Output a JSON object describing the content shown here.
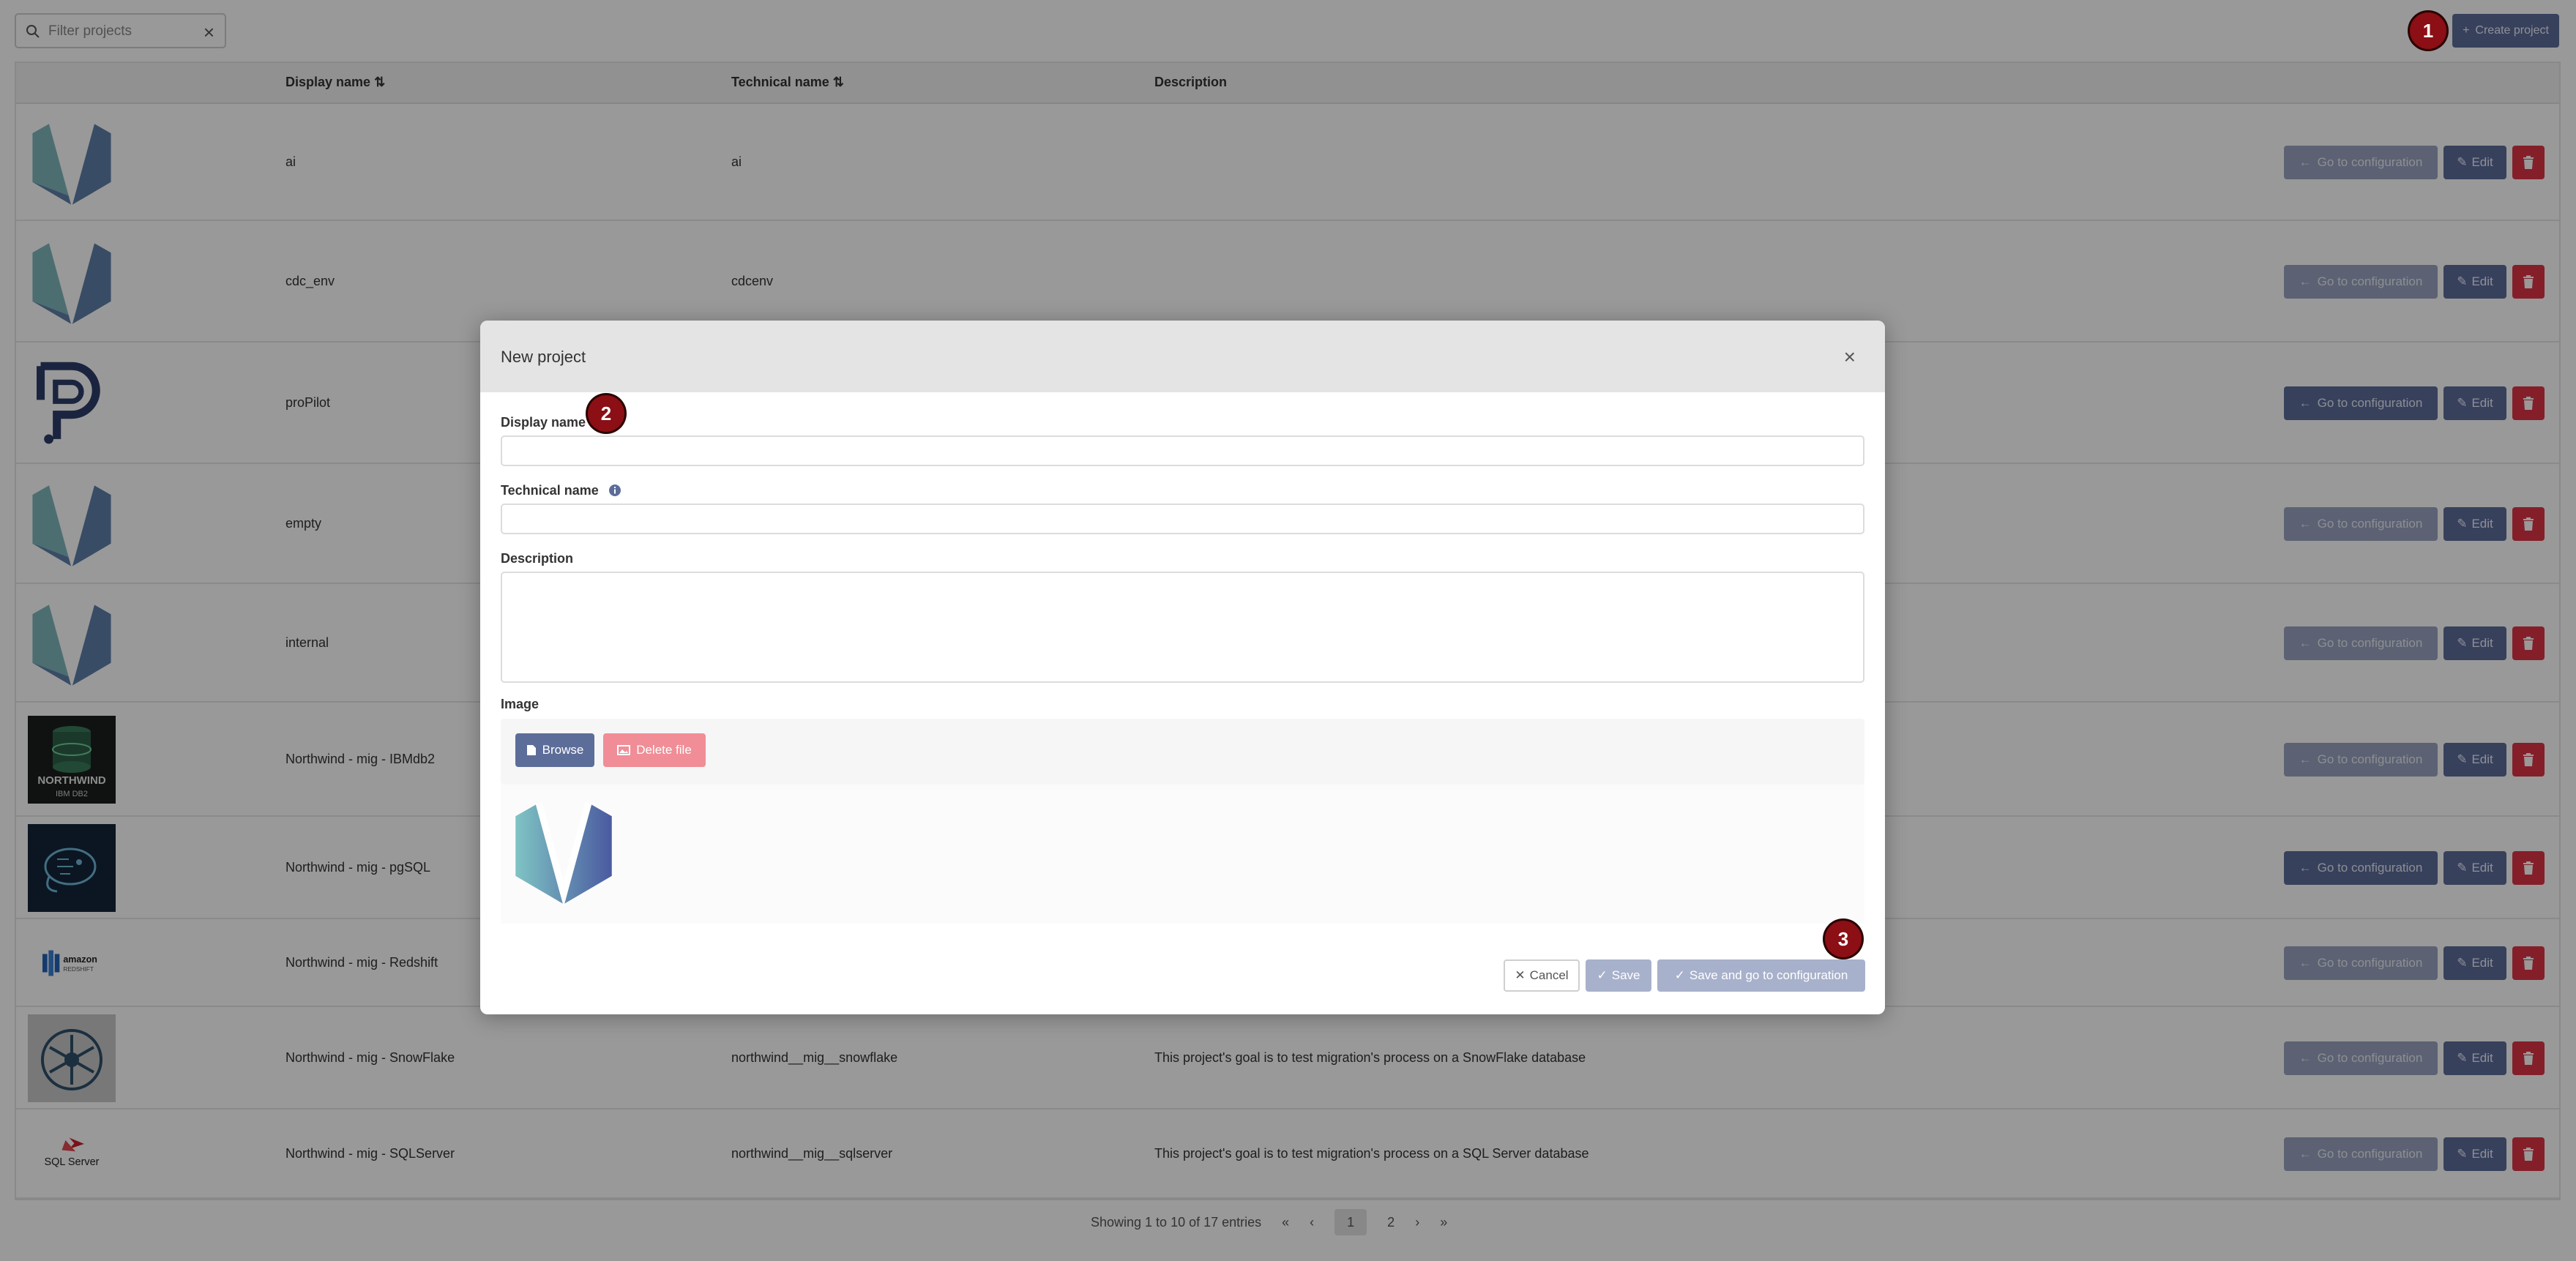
{
  "filter": {
    "placeholder": "Filter projects",
    "clear": "×"
  },
  "create_button": {
    "label": "Create project",
    "icon": "plus-icon"
  },
  "table": {
    "headers": {
      "display_name": "Display name",
      "technical_name": "Technical name",
      "description": "Description"
    },
    "sort_glyph": "⇅",
    "rows": [
      {
        "display_name": "ai",
        "technical_name": "ai",
        "description": "",
        "logo": "vorteks"
      },
      {
        "display_name": "cdc_env",
        "technical_name": "cdcenv",
        "description": "",
        "logo": "vorteks"
      },
      {
        "display_name": "proPilot",
        "technical_name": "",
        "description": "",
        "logo": "propilot"
      },
      {
        "display_name": "empty",
        "technical_name": "",
        "description": "",
        "logo": "vorteks"
      },
      {
        "display_name": "internal",
        "technical_name": "",
        "description": "",
        "logo": "vorteks"
      },
      {
        "display_name": "Northwind - mig - IBMdb2",
        "technical_name": "",
        "description": "",
        "logo": "northwind",
        "logo_text_1": "NORTHWIND",
        "logo_text_2": "IBM DB2"
      },
      {
        "display_name": "Northwind - mig - pgSQL",
        "technical_name": "",
        "description": "",
        "logo": "pgsql"
      },
      {
        "display_name": "Northwind - mig - Redshift",
        "technical_name": "",
        "description": "",
        "logo": "redshift",
        "logo_text_1": "amazon",
        "logo_text_2": "REDSHIFT"
      },
      {
        "display_name": "Northwind - mig - SnowFlake",
        "technical_name": "northwind__mig__snowflake",
        "description": "This project's goal is to test migration's process on a SnowFlake database",
        "logo": "snowflake"
      },
      {
        "display_name": "Northwind - mig - SQLServer",
        "technical_name": "northwind__mig__sqlserver",
        "description": "This project's goal is to test migration's process on a SQL Server database",
        "logo": "sqlserver",
        "logo_text_1": "SQL Server"
      }
    ],
    "actions": {
      "go_label": "Go to configuration",
      "edit_label": "Edit"
    }
  },
  "pagination": {
    "summary": "Showing 1 to 10 of 17 entries",
    "first": "«",
    "prev": "‹",
    "pages": [
      "1",
      "2"
    ],
    "next": "›",
    "last": "»"
  },
  "modal": {
    "title": "New project",
    "close": "×",
    "display_name_label": "Display name",
    "display_name_value": "",
    "technical_name_label": "Technical name",
    "technical_name_value": "",
    "description_label": "Description",
    "description_value": "",
    "image_label": "Image",
    "browse_label": "Browse",
    "delete_file_label": "Delete file",
    "cancel_label": "Cancel",
    "save_label": "Save",
    "save_config_label": "Save and go to configuration"
  },
  "markers": [
    "1",
    "2",
    "3"
  ],
  "colors": {
    "primary": "#5d6d9a",
    "danger": "#dc3545",
    "marker": "#8b0f14"
  }
}
